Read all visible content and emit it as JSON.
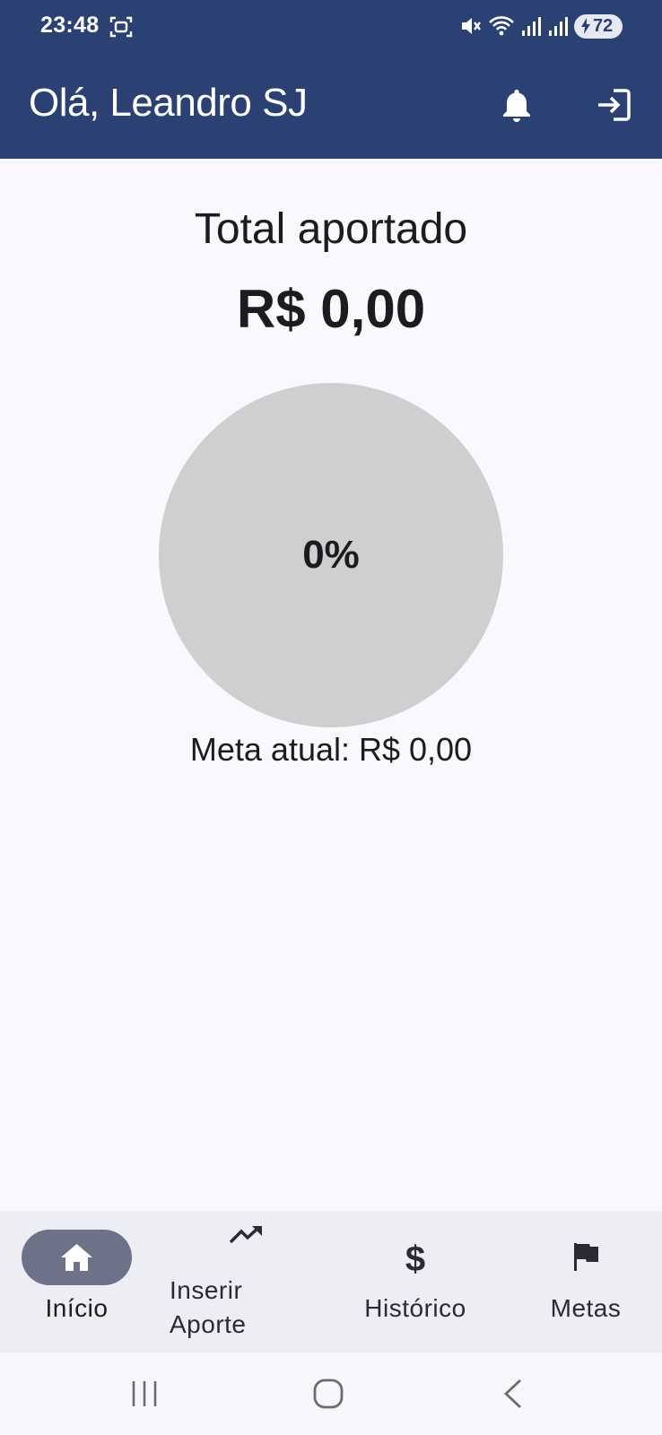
{
  "status_bar": {
    "time": "23:48",
    "battery": "72",
    "icons": [
      "screenshot-icon",
      "mute-icon",
      "wifi-icon",
      "signal-icon",
      "signal-icon",
      "battery-charging-icon"
    ]
  },
  "header": {
    "greeting": "Olá, Leandro SJ",
    "icons": [
      "bell-icon",
      "logout-icon"
    ]
  },
  "main": {
    "total_label": "Total aportado",
    "total_value": "R$ 0,00",
    "progress_percent": 0,
    "progress_label": "0%",
    "meta_label": "Meta atual: R$ 0,00"
  },
  "bottom_nav": {
    "items": [
      {
        "label": "Início",
        "icon": "home-icon",
        "active": true
      },
      {
        "label": "Inserir\nAporte",
        "icon": "trending-up-icon",
        "active": false
      },
      {
        "label": "Histórico",
        "icon": "dollar-icon",
        "active": false
      },
      {
        "label": "Metas",
        "icon": "flag-icon",
        "active": false
      }
    ]
  },
  "system_nav": {
    "icons": [
      "recent-apps-icon",
      "home-button-icon",
      "back-icon"
    ]
  },
  "colors": {
    "appbar": "#2b4073",
    "background": "#f8f8fd",
    "progress_track": "#cfcfcf",
    "nav_active_pill": "#6d7289",
    "nav_background": "#ededf4"
  }
}
